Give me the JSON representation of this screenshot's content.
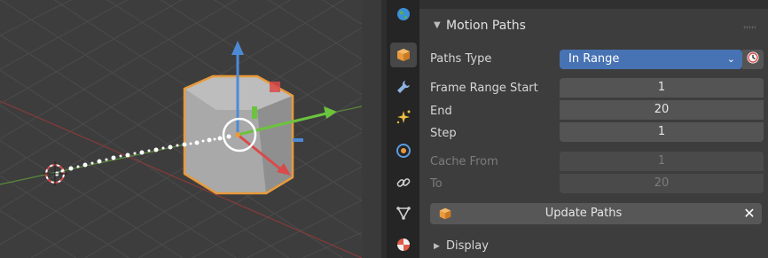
{
  "panel": {
    "title": "Motion Paths",
    "paths_type_label": "Paths Type",
    "paths_type_value": "In Range",
    "frame_range_start_label": "Frame Range Start",
    "frame_range_start_value": "1",
    "end_label": "End",
    "end_value": "20",
    "step_label": "Step",
    "step_value": "1",
    "cache_from_label": "Cache From",
    "cache_from_value": "1",
    "to_label": "To",
    "to_value": "20",
    "update_paths_label": "Update Paths",
    "clear_label": "✕",
    "display_label": "Display"
  },
  "tabs": [
    {
      "name": "world",
      "icon": "world-icon",
      "active": false
    },
    {
      "name": "object",
      "icon": "object-cube-icon",
      "active": true
    },
    {
      "name": "modifiers",
      "icon": "wrench-icon",
      "active": false
    },
    {
      "name": "particles",
      "icon": "particles-icon",
      "active": false
    },
    {
      "name": "physics",
      "icon": "physics-icon",
      "active": false
    },
    {
      "name": "constraints",
      "icon": "constraint-icon",
      "active": false
    },
    {
      "name": "object-data",
      "icon": "mesh-data-icon",
      "active": false
    },
    {
      "name": "material",
      "icon": "material-icon",
      "active": false
    }
  ],
  "colors": {
    "accent_blue": "#4772b3",
    "selection_orange": "#e89a3c",
    "x_axis": "#d94a4a",
    "y_axis": "#6cc33e",
    "z_axis": "#4d8ad6"
  }
}
